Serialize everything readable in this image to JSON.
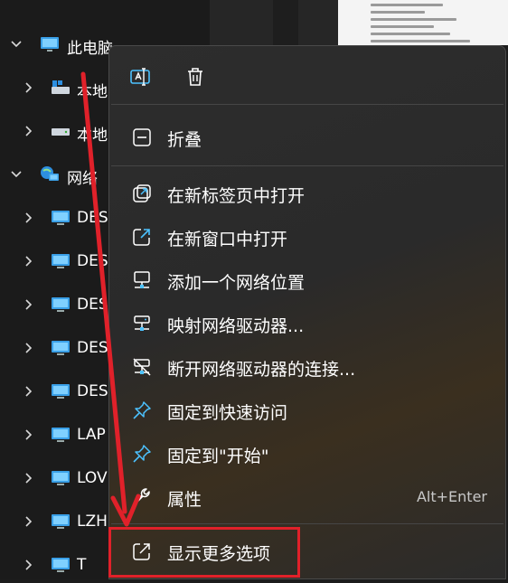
{
  "nav": {
    "items": [
      {
        "label": "此电脑",
        "icon": "monitor-icon"
      },
      {
        "label": "本地",
        "icon": "drive-icon"
      },
      {
        "label": "本地",
        "icon": "drive-icon"
      },
      {
        "label": "网络",
        "icon": "network-icon"
      },
      {
        "label": "DES",
        "icon": "monitor-icon"
      },
      {
        "label": "DES",
        "icon": "monitor-icon"
      },
      {
        "label": "DES",
        "icon": "monitor-icon"
      },
      {
        "label": "DES",
        "icon": "monitor-icon"
      },
      {
        "label": "DES",
        "icon": "monitor-icon"
      },
      {
        "label": "LAP",
        "icon": "monitor-icon"
      },
      {
        "label": "LOV",
        "icon": "monitor-icon"
      },
      {
        "label": "LZH",
        "icon": "monitor-icon"
      },
      {
        "label": "T",
        "icon": "monitor-icon"
      }
    ]
  },
  "menu": {
    "toolbar": [
      {
        "icon": "rename-icon"
      },
      {
        "icon": "trash-icon"
      }
    ],
    "items": [
      {
        "label": "折叠",
        "icon": "collapse-icon"
      },
      {
        "label": "在新标签页中打开",
        "icon": "new-tab-icon"
      },
      {
        "label": "在新窗口中打开",
        "icon": "new-window-icon"
      },
      {
        "label": "添加一个网络位置",
        "icon": "add-network-location-icon"
      },
      {
        "label": "映射网络驱动器...",
        "icon": "map-drive-icon"
      },
      {
        "label": "断开网络驱动器的连接...",
        "icon": "disconnect-drive-icon"
      },
      {
        "label": "固定到快速访问",
        "icon": "pin-icon"
      },
      {
        "label": "固定到\"开始\"",
        "icon": "pin-icon"
      },
      {
        "label": "属性",
        "icon": "wrench-icon",
        "shortcut": "Alt+Enter"
      },
      {
        "label": "显示更多选项",
        "icon": "more-options-icon"
      }
    ]
  },
  "colors": {
    "annotation": "#e0212a",
    "accent": "#4cc2ff"
  }
}
